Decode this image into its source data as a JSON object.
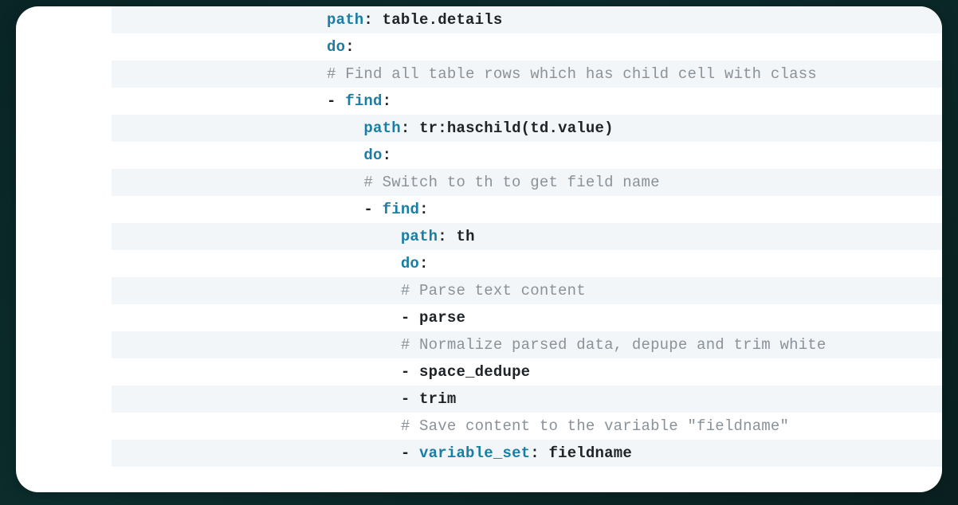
{
  "indent_unit": "    ",
  "base_indent": 0,
  "lines": [
    {
      "indent": 0,
      "tokens": [
        {
          "t": "key",
          "v": "path"
        },
        {
          "t": "colon",
          "v": ": "
        },
        {
          "t": "text",
          "v": "table.details"
        }
      ]
    },
    {
      "indent": 0,
      "tokens": [
        {
          "t": "key",
          "v": "do"
        },
        {
          "t": "colon",
          "v": ":"
        }
      ]
    },
    {
      "indent": 0,
      "tokens": [
        {
          "t": "comment",
          "v": "# Find all table rows which has child cell with class"
        }
      ]
    },
    {
      "indent": 0,
      "tokens": [
        {
          "t": "dash",
          "v": "- "
        },
        {
          "t": "key",
          "v": "find"
        },
        {
          "t": "colon",
          "v": ":"
        }
      ]
    },
    {
      "indent": 1,
      "tokens": [
        {
          "t": "key",
          "v": "path"
        },
        {
          "t": "colon",
          "v": ": "
        },
        {
          "t": "text",
          "v": "tr:haschild(td.value)"
        }
      ]
    },
    {
      "indent": 1,
      "tokens": [
        {
          "t": "key",
          "v": "do"
        },
        {
          "t": "colon",
          "v": ":"
        }
      ]
    },
    {
      "indent": 1,
      "tokens": [
        {
          "t": "comment",
          "v": "# Switch to th to get field name"
        }
      ]
    },
    {
      "indent": 1,
      "tokens": [
        {
          "t": "dash",
          "v": "- "
        },
        {
          "t": "key",
          "v": "find"
        },
        {
          "t": "colon",
          "v": ":"
        }
      ]
    },
    {
      "indent": 2,
      "tokens": [
        {
          "t": "key",
          "v": "path"
        },
        {
          "t": "colon",
          "v": ": "
        },
        {
          "t": "text",
          "v": "th"
        }
      ]
    },
    {
      "indent": 2,
      "tokens": [
        {
          "t": "key",
          "v": "do"
        },
        {
          "t": "colon",
          "v": ":"
        }
      ]
    },
    {
      "indent": 2,
      "tokens": [
        {
          "t": "comment",
          "v": "# Parse text content"
        }
      ]
    },
    {
      "indent": 2,
      "tokens": [
        {
          "t": "dash",
          "v": "- "
        },
        {
          "t": "text",
          "v": "parse"
        }
      ]
    },
    {
      "indent": 2,
      "tokens": [
        {
          "t": "comment",
          "v": "# Normalize parsed data, depupe and trim white"
        }
      ]
    },
    {
      "indent": 2,
      "tokens": [
        {
          "t": "dash",
          "v": "- "
        },
        {
          "t": "text",
          "v": "space_dedupe"
        }
      ]
    },
    {
      "indent": 2,
      "tokens": [
        {
          "t": "dash",
          "v": "- "
        },
        {
          "t": "text",
          "v": "trim"
        }
      ]
    },
    {
      "indent": 2,
      "tokens": [
        {
          "t": "comment",
          "v": "# Save content to the variable \"fieldname\""
        }
      ]
    },
    {
      "indent": 2,
      "tokens": [
        {
          "t": "dash",
          "v": "- "
        },
        {
          "t": "key",
          "v": "variable_set"
        },
        {
          "t": "colon",
          "v": ": "
        },
        {
          "t": "text",
          "v": "fieldname"
        }
      ]
    }
  ]
}
